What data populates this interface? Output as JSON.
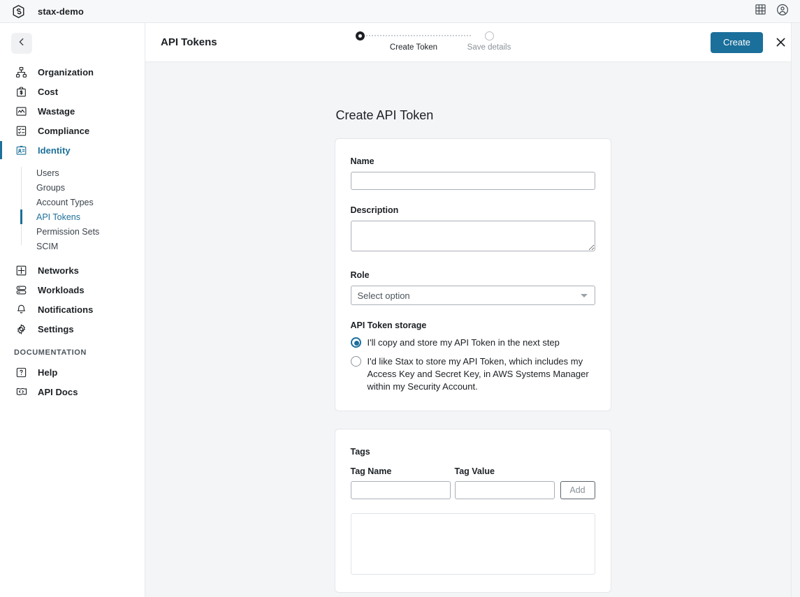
{
  "topbar": {
    "logo_icon": "stax-hex-logo-icon",
    "title": "stax-demo",
    "grid_icon": "grid-apps-icon",
    "account_icon": "account-circle-icon"
  },
  "sidebar": {
    "back_icon": "chevron-left-icon",
    "items": [
      {
        "label": "Organization",
        "icon": "org-chart-icon",
        "active": false
      },
      {
        "label": "Cost",
        "icon": "cost-briefcase-dollar-icon",
        "active": false
      },
      {
        "label": "Wastage",
        "icon": "wastage-chart-icon",
        "active": false
      },
      {
        "label": "Compliance",
        "icon": "compliance-checklist-icon",
        "active": false
      },
      {
        "label": "Identity",
        "icon": "identity-badge-icon",
        "active": true
      }
    ],
    "subitems": [
      {
        "label": "Users",
        "active": false
      },
      {
        "label": "Groups",
        "active": false
      },
      {
        "label": "Account Types",
        "active": false
      },
      {
        "label": "API Tokens",
        "active": true
      },
      {
        "label": "Permission Sets",
        "active": false
      },
      {
        "label": "SCIM",
        "active": false
      }
    ],
    "items2": [
      {
        "label": "Networks",
        "icon": "networks-move-icon",
        "active": false
      },
      {
        "label": "Workloads",
        "icon": "workloads-stack-icon",
        "active": false
      },
      {
        "label": "Notifications",
        "icon": "bell-icon",
        "active": false
      },
      {
        "label": "Settings",
        "icon": "gear-icon",
        "active": false
      }
    ],
    "section_label": "DOCUMENTATION",
    "items3": [
      {
        "label": "Help",
        "icon": "question-box-icon",
        "active": false
      },
      {
        "label": "API Docs",
        "icon": "api-docs-code-flag-icon",
        "active": false
      }
    ]
  },
  "header": {
    "page_title": "API Tokens",
    "steps": [
      {
        "label": "Create Token",
        "state": "active"
      },
      {
        "label": "Save details",
        "state": "inactive"
      }
    ],
    "create_label": "Create",
    "close_icon": "close-x-icon"
  },
  "form": {
    "heading": "Create API Token",
    "name": {
      "label": "Name",
      "value": "",
      "placeholder": ""
    },
    "description": {
      "label": "Description",
      "value": "",
      "placeholder": ""
    },
    "role": {
      "label": "Role",
      "selected": "Select option"
    },
    "storage": {
      "label": "API Token storage",
      "options": [
        {
          "text": "I'll copy and store my API Token in the next step",
          "selected": true
        },
        {
          "text": "I'd like Stax to store my API Token, which includes my Access Key and Secret Key, in AWS Systems Manager within my Security Account.",
          "selected": false
        }
      ]
    }
  },
  "tags": {
    "title": "Tags",
    "name_header": "Tag Name",
    "value_header": "Tag Value",
    "name_value": "",
    "value_value": "",
    "add_label": "Add"
  },
  "colors": {
    "accent": "#1b6f9b",
    "page_bg": "#f4f5f7",
    "topbar_bg": "#f7f8f9",
    "text": "#1c2024",
    "muted": "#8b9299",
    "border": "#e7e9ec"
  }
}
